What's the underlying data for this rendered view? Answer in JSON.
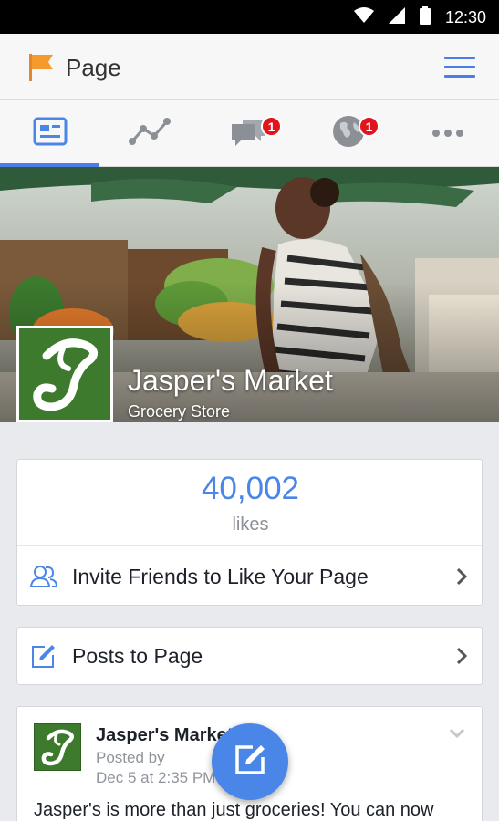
{
  "status_bar": {
    "time": "12:30"
  },
  "app_bar": {
    "title": "Page"
  },
  "tabs": [
    {
      "name": "overview",
      "icon": "page-card-icon",
      "active": true
    },
    {
      "name": "insights",
      "icon": "line-graph-icon"
    },
    {
      "name": "messages",
      "icon": "chat-bubbles-icon",
      "badge": "1"
    },
    {
      "name": "notifications",
      "icon": "globe-icon",
      "badge": "1"
    },
    {
      "name": "more",
      "icon": "more-dots-icon"
    }
  ],
  "page": {
    "name": "Jasper's Market",
    "category": "Grocery Store"
  },
  "likes": {
    "count": "40,002",
    "label": "likes",
    "invite_label": "Invite Friends to Like Your Page"
  },
  "posts_to_page": {
    "label": "Posts to Page"
  },
  "post": {
    "author": "Jasper's Market",
    "meta_line1": "Posted by",
    "meta_line2": "Dec 5 at 2:35 PM",
    "text": "Jasper's is more than just groceries! You can now"
  },
  "colors": {
    "accent": "#4a86e8",
    "badge": "#e1141e",
    "brand_green": "#3e7a2d"
  }
}
